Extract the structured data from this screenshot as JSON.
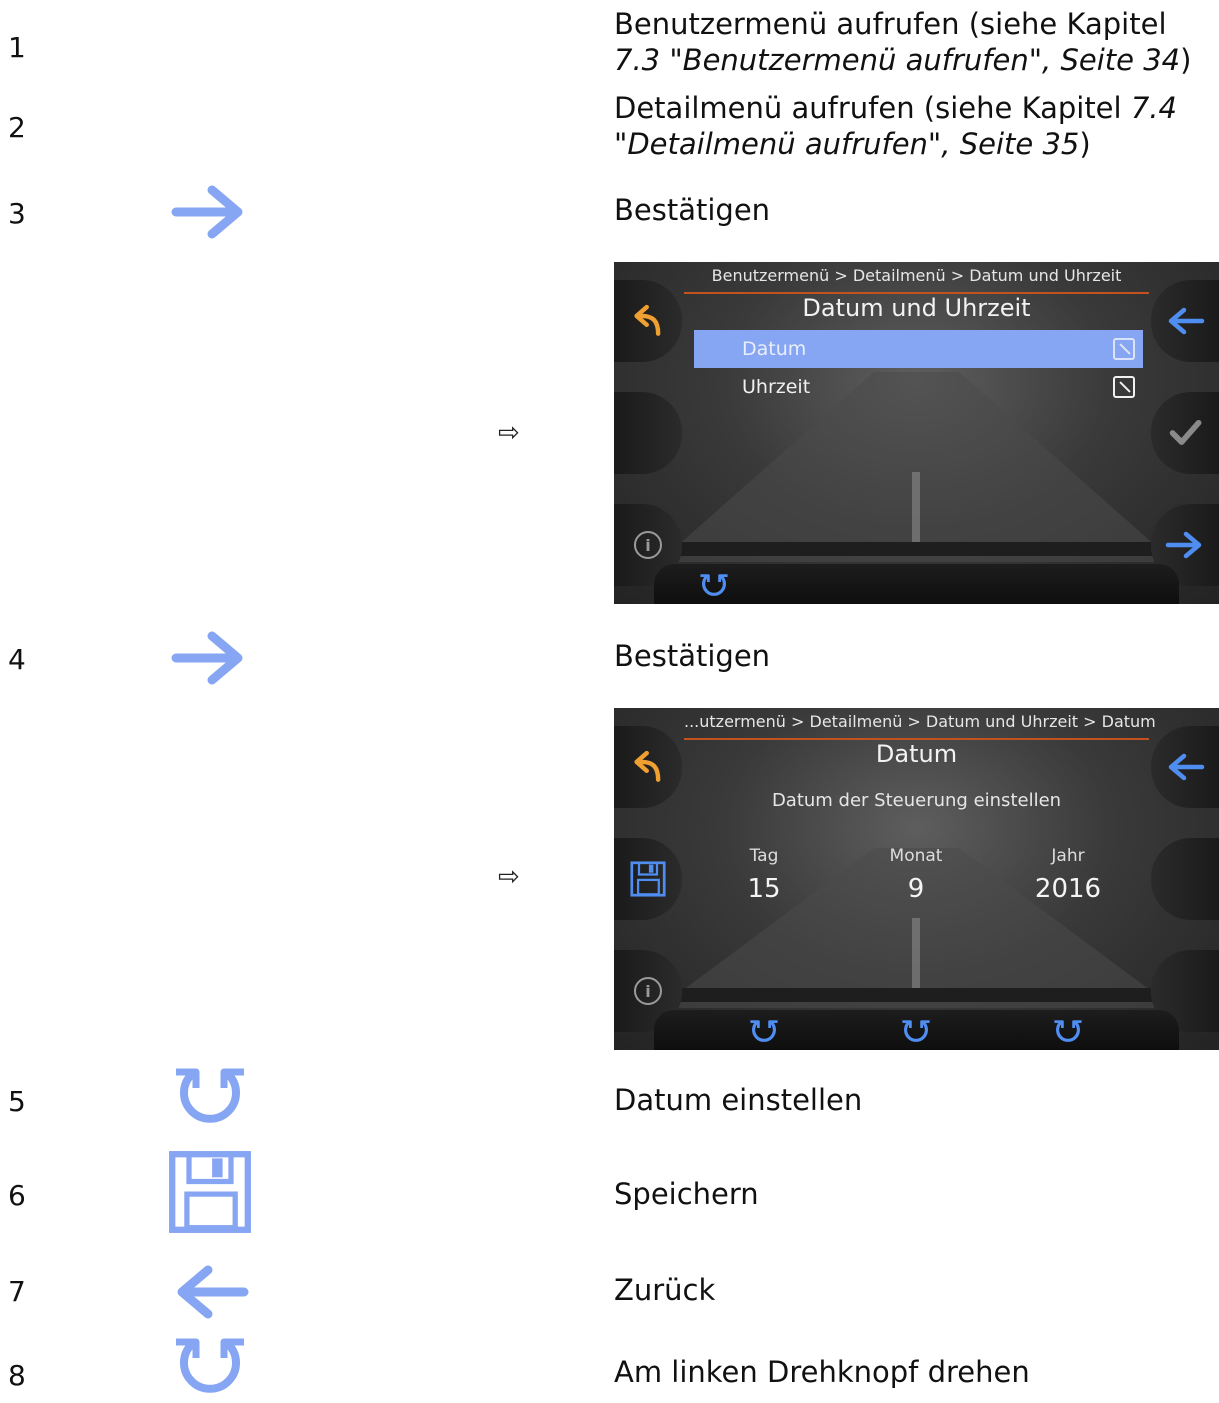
{
  "steps": [
    {
      "number": "1",
      "text_plain": "Benutzermenü aufrufen (siehe Kapitel ",
      "text_ref": "7.3 \"Benutzermenü aufrufen\", Seite 34",
      "text_end": ")"
    },
    {
      "number": "2",
      "text_plain": "Detailmenü aufrufen (siehe Kapitel ",
      "text_ref": "7.4 \"Detailmenü aufrufen\", Seite 35",
      "text_end": ")"
    },
    {
      "number": "3",
      "icon": "arrow-right-icon",
      "text": "Bestätigen"
    },
    {
      "number": "4",
      "icon": "arrow-right-icon",
      "text": "Bestätigen"
    },
    {
      "number": "5",
      "icon": "rotate-knob-icon",
      "text": "Datum einstellen"
    },
    {
      "number": "6",
      "icon": "save-floppy-icon",
      "text": "Speichern"
    },
    {
      "number": "7",
      "icon": "arrow-left-icon",
      "text": "Zurück"
    },
    {
      "number": "8",
      "icon": "rotate-knob-icon",
      "text": "Am linken Drehknopf drehen"
    }
  ],
  "result_arrow": "⇨",
  "screen1": {
    "breadcrumb": "Benutzermenü > Detailmenü > Datum und Uhrzeit",
    "title": "Datum und Uhrzeit",
    "items": [
      {
        "label": "Datum",
        "selected": true
      },
      {
        "label": "Uhrzeit",
        "selected": false
      }
    ]
  },
  "screen2": {
    "breadcrumb": "...utzermenü > Detailmenü > Datum und Uhrzeit > Datum",
    "title": "Datum",
    "subtitle": "Datum der Steuerung einstellen",
    "fields": [
      {
        "label": "Tag",
        "value": "15"
      },
      {
        "label": "Monat",
        "value": "9"
      },
      {
        "label": "Jahr",
        "value": "2016"
      }
    ]
  },
  "colors": {
    "icon_blue": "#86a5f2",
    "icon_blue_bright": "#4f8df0",
    "back_orange": "#f0a030",
    "accent_line": "#c4521f",
    "check_gray": "#8a8a8a"
  }
}
